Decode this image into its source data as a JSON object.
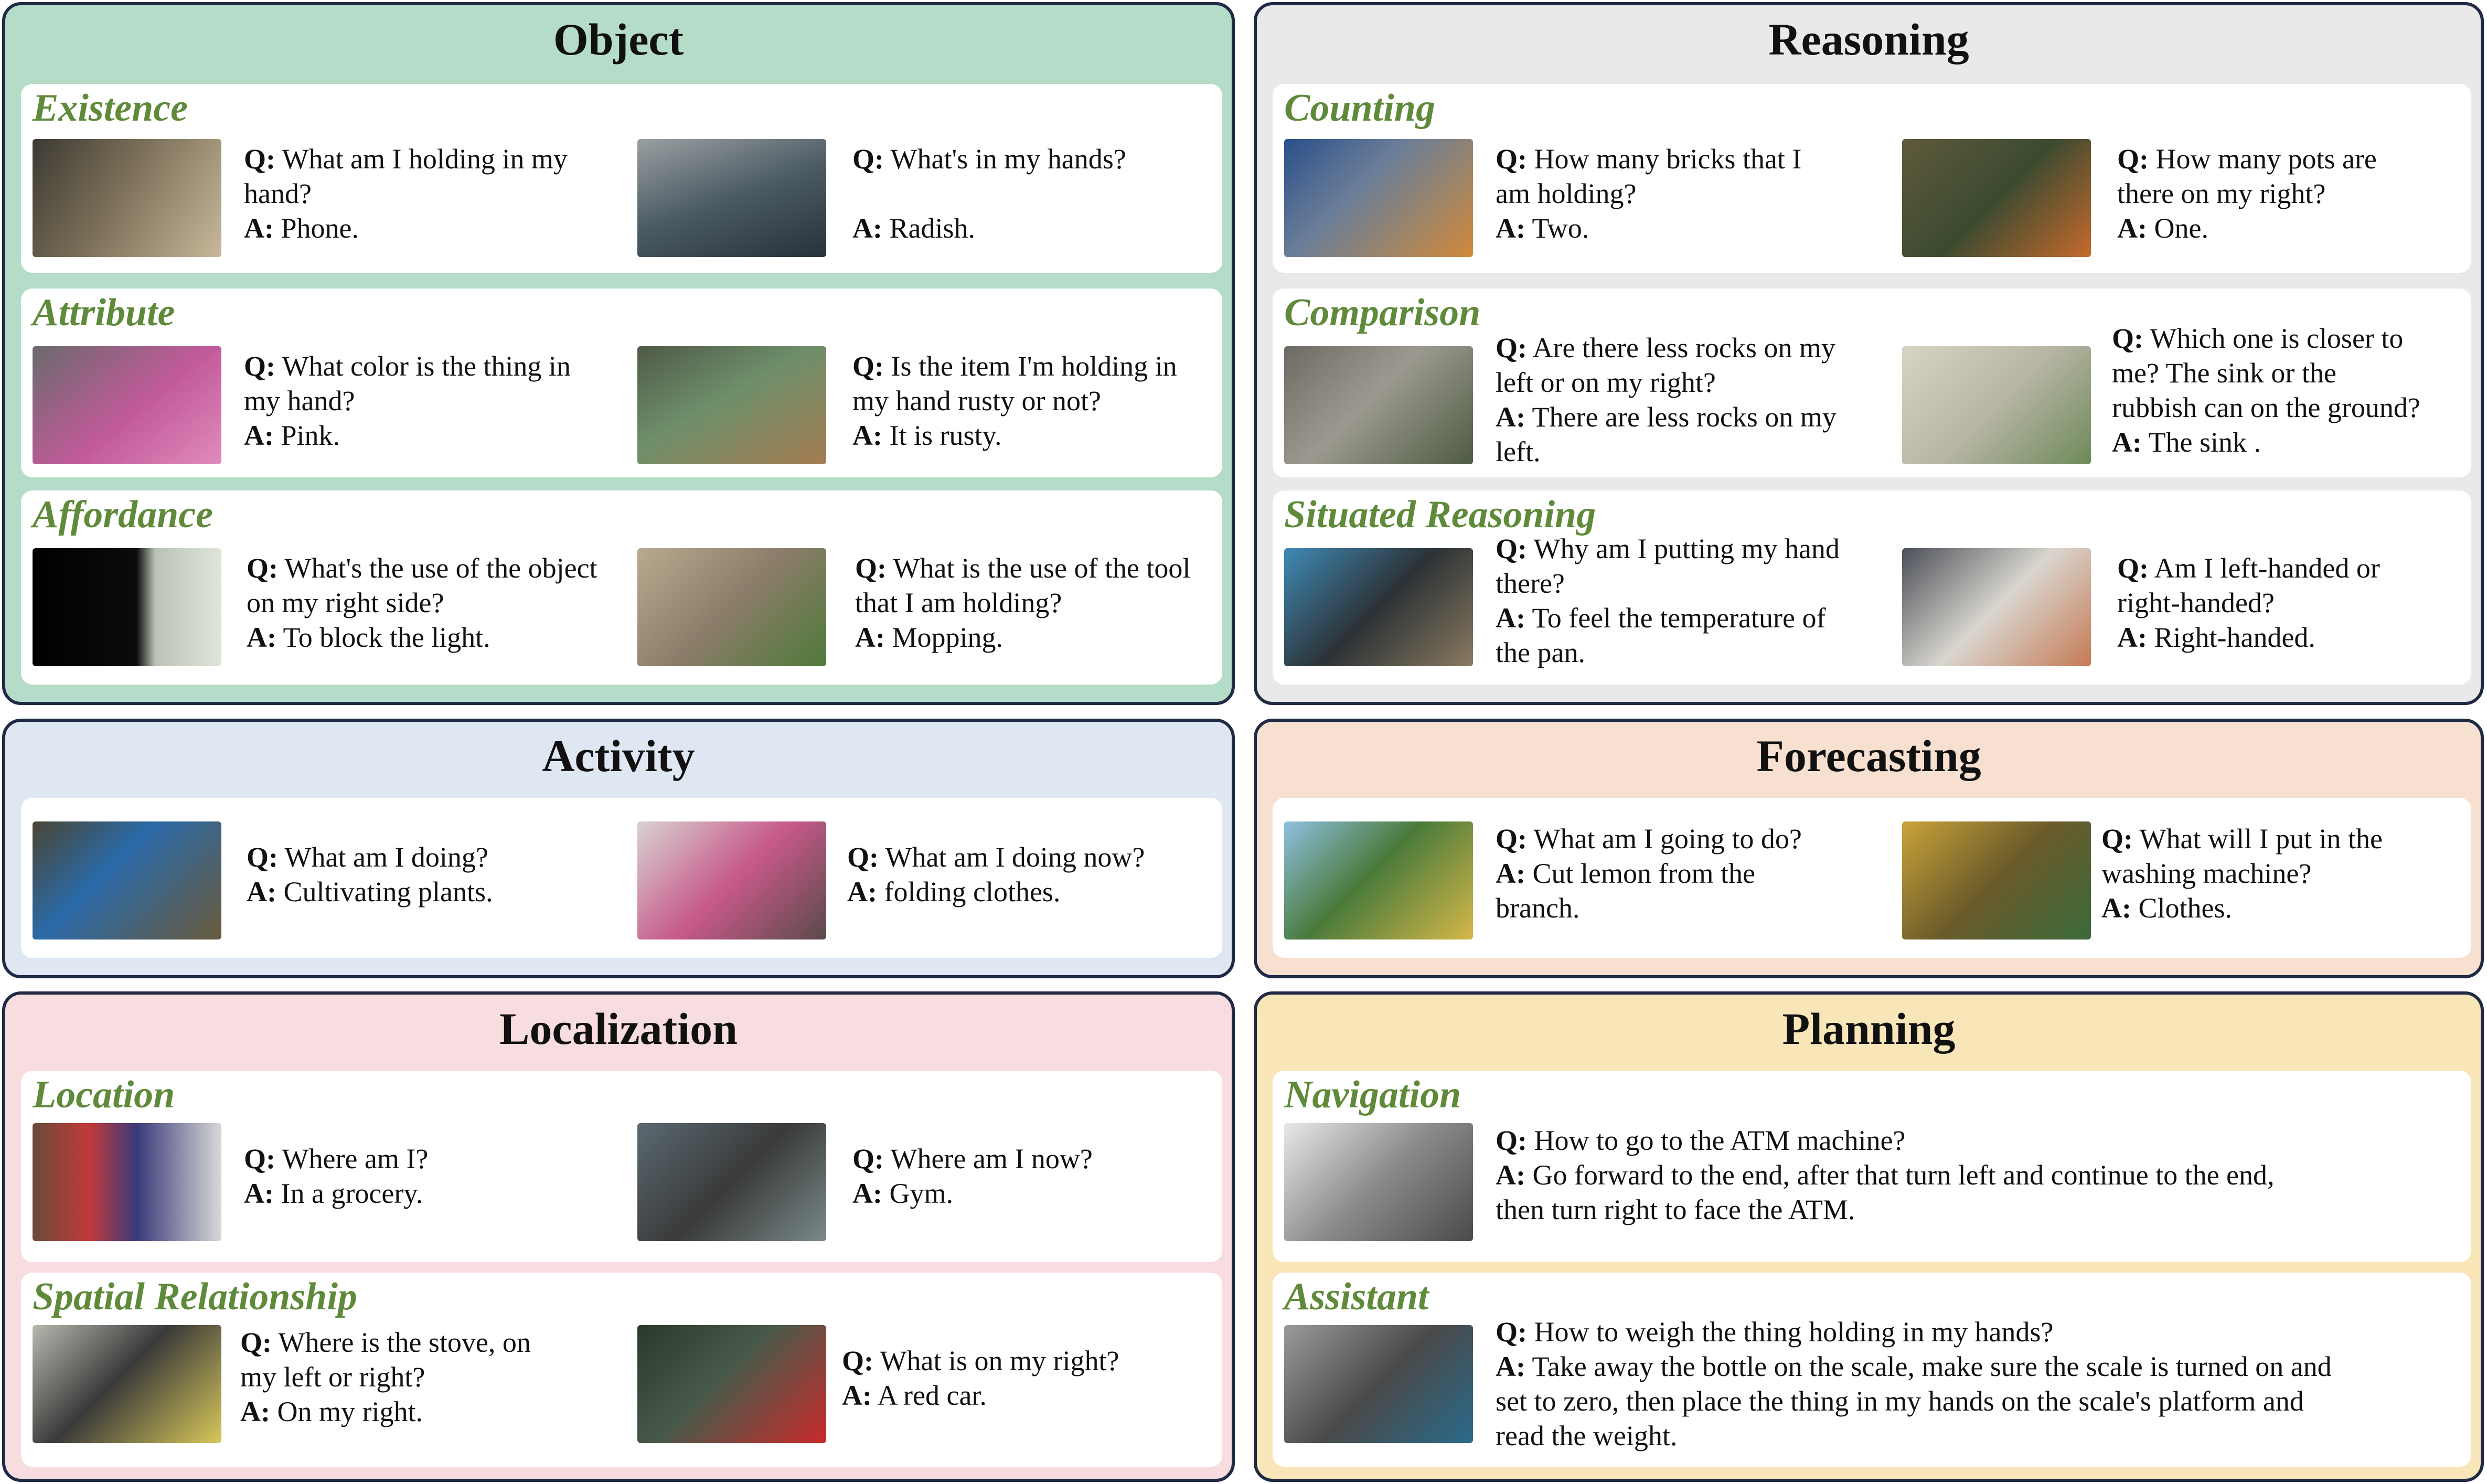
{
  "colors": {
    "object_bg": "#b5dcc8",
    "reasoning_bg": "#e9e9e9",
    "activity_bg": "#dfe7f3",
    "forecasting_bg": "#f7e0d0",
    "localization_bg": "#f8dde0",
    "planning_bg": "#f8e6b8",
    "subtitle_green": "#5f8a3a",
    "border_navy": "#1f2a44"
  },
  "q_key": "Q:",
  "a_key": "A:",
  "panels": {
    "object": {
      "title": "Object",
      "existence": {
        "subtitle": "Existence",
        "ex1": {
          "q": [
            "What am I holding in my",
            "hand?"
          ],
          "a": [
            "Phone."
          ]
        },
        "ex2": {
          "q": [
            "What's in my hands?"
          ],
          "a": [
            "Radish."
          ]
        }
      },
      "attribute": {
        "subtitle": "Attribute",
        "ex1": {
          "q": [
            "What color is the thing in",
            "my hand?"
          ],
          "a": [
            "Pink."
          ]
        },
        "ex2": {
          "q": [
            "Is the item I'm holding in",
            "my hand rusty or not?"
          ],
          "a": [
            "It is rusty."
          ]
        }
      },
      "affordance": {
        "subtitle": "Affordance",
        "ex1": {
          "q": [
            "What's the use of the object",
            "on my right side?"
          ],
          "a": [
            "To block the light."
          ]
        },
        "ex2": {
          "q": [
            "What is the use of the tool",
            "that I am holding?"
          ],
          "a": [
            "Mopping."
          ]
        }
      }
    },
    "reasoning": {
      "title": "Reasoning",
      "counting": {
        "subtitle": "Counting",
        "ex1": {
          "q": [
            "How many bricks that I",
            "am holding?"
          ],
          "a": [
            "Two."
          ]
        },
        "ex2": {
          "q": [
            "How many pots are",
            "there on my right?"
          ],
          "a": [
            "One."
          ]
        }
      },
      "comparison": {
        "subtitle": "Comparison",
        "ex1": {
          "q": [
            "Are there less rocks on my",
            "left or on my right?"
          ],
          "a": [
            "There are less rocks on my",
            "left."
          ]
        },
        "ex2": {
          "q": [
            "Which one is closer to",
            "me? The sink or the",
            "rubbish can on the ground?"
          ],
          "a": [
            "The sink ."
          ]
        }
      },
      "situated": {
        "subtitle": "Situated Reasoning",
        "ex1": {
          "q": [
            "Why am I putting my hand",
            "there?"
          ],
          "a": [
            "To feel the temperature of",
            "the pan."
          ]
        },
        "ex2": {
          "q": [
            "Am I left-handed or",
            "right-handed?"
          ],
          "a": [
            "Right-handed."
          ]
        }
      }
    },
    "activity": {
      "title": "Activity",
      "ex1": {
        "q": [
          "What am I doing?"
        ],
        "a": [
          "Cultivating plants."
        ]
      },
      "ex2": {
        "q": [
          "What am I doing now?"
        ],
        "a": [
          "folding clothes."
        ]
      }
    },
    "forecasting": {
      "title": "Forecasting",
      "ex1": {
        "q": [
          "What am I going to do?"
        ],
        "a": [
          "Cut lemon from the",
          "branch."
        ]
      },
      "ex2": {
        "q": [
          "What will I put in the",
          "washing machine?"
        ],
        "a": [
          "Clothes."
        ]
      }
    },
    "localization": {
      "title": "Localization",
      "location": {
        "subtitle": "Location",
        "ex1": {
          "q": [
            "Where am I?"
          ],
          "a": [
            "In a grocery."
          ]
        },
        "ex2": {
          "q": [
            "Where am I now?"
          ],
          "a": [
            "Gym."
          ]
        }
      },
      "spatial": {
        "subtitle": "Spatial Relationship",
        "ex1": {
          "q": [
            "Where is the stove, on",
            "my left or right?"
          ],
          "a": [
            "On my right."
          ]
        },
        "ex2": {
          "q": [
            "What is on my right?"
          ],
          "a": [
            "A red car."
          ]
        }
      }
    },
    "planning": {
      "title": "Planning",
      "navigation": {
        "subtitle": "Navigation",
        "ex1": {
          "q": [
            "How to go to the ATM machine?"
          ],
          "a": [
            "Go forward to the end, after that turn left and continue to the end,",
            "then turn right to face the ATM."
          ]
        }
      },
      "assistant": {
        "subtitle": "Assistant",
        "ex1": {
          "q": [
            "How to weigh the thing holding in my hands?"
          ],
          "a": [
            "Take away the bottle on the scale, make sure the scale is turned on and",
            "set to zero, then place the thing in my hands on the scale's platform and",
            "read the weight."
          ]
        }
      }
    }
  }
}
